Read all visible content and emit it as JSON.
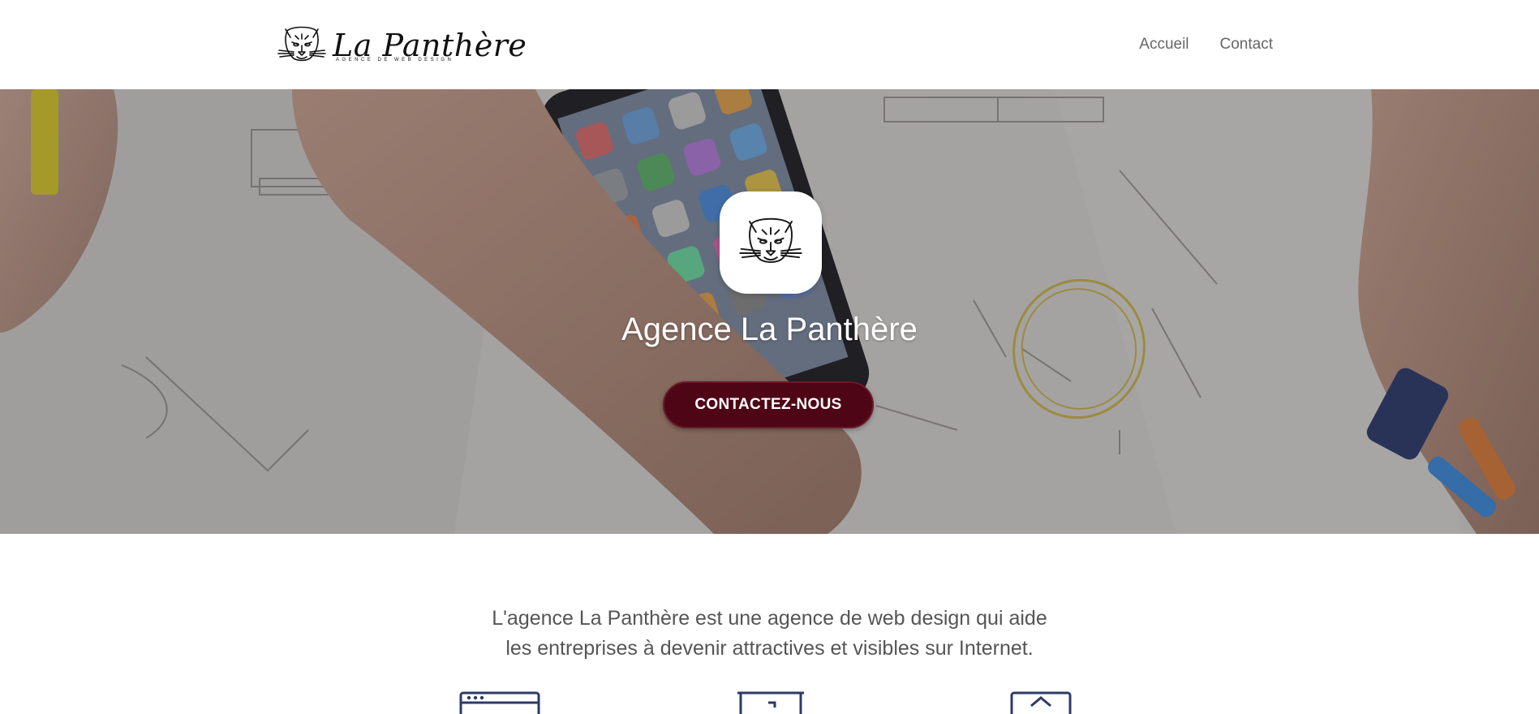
{
  "brand": {
    "name": "La Panthère",
    "tagline": "AGENCE DE WEB DESIGN"
  },
  "nav": {
    "items": [
      {
        "label": "Accueil"
      },
      {
        "label": "Contact"
      }
    ]
  },
  "hero": {
    "title": "Agence La Panthère",
    "cta_label": "CONTACTEZ-NOUS",
    "cta_color": "#4e0616"
  },
  "intro": {
    "line1": "L'agence La Panthère est une agence de web design qui aide",
    "line2": "les entreprises à devenir attractives et visibles sur Internet."
  },
  "features": {
    "icons": [
      "browser-window-icon",
      "presentation-board-icon",
      "home-window-icon"
    ]
  },
  "colors": {
    "accent": "#4e0616",
    "icon_blue": "#2d3a66"
  }
}
